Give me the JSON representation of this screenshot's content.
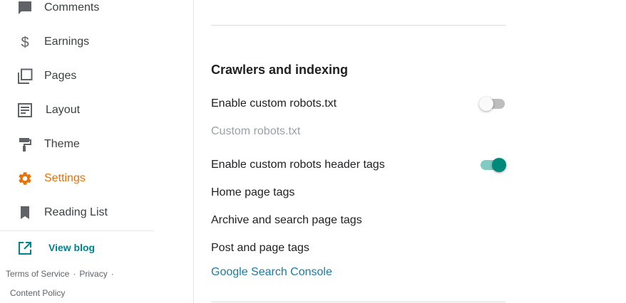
{
  "sidebar": {
    "items": [
      {
        "label": "Comments",
        "icon": "comment-icon"
      },
      {
        "label": "Earnings",
        "icon": "dollar-icon"
      },
      {
        "label": "Pages",
        "icon": "pages-icon"
      },
      {
        "label": "Layout",
        "icon": "layout-icon"
      },
      {
        "label": "Theme",
        "icon": "paint-roller-icon"
      },
      {
        "label": "Settings",
        "icon": "gear-icon",
        "active": true
      },
      {
        "label": "Reading List",
        "icon": "bookmark-icon"
      }
    ],
    "view_blog": {
      "label": "View blog",
      "icon": "external-link-icon"
    },
    "footer": {
      "terms": "Terms of Service",
      "privacy": "Privacy",
      "separator": "·",
      "content_policy": "Content Policy"
    }
  },
  "main": {
    "section_title": "Crawlers and indexing",
    "rows": {
      "enable_robots_txt": {
        "label": "Enable custom robots.txt",
        "enabled": false
      },
      "custom_robots_txt": {
        "label": "Custom robots.txt",
        "disabled": true
      },
      "enable_robots_header": {
        "label": "Enable custom robots header tags",
        "enabled": true
      },
      "home_page_tags": {
        "label": "Home page tags"
      },
      "archive_search_tags": {
        "label": "Archive and search page tags"
      },
      "post_page_tags": {
        "label": "Post and page tags"
      }
    },
    "search_console_link": "Google Search Console"
  },
  "colors": {
    "accent_active": "#e8710a",
    "toggle_on": "#00897b",
    "link": "#1e7aa0",
    "view_blog": "#00838f"
  }
}
